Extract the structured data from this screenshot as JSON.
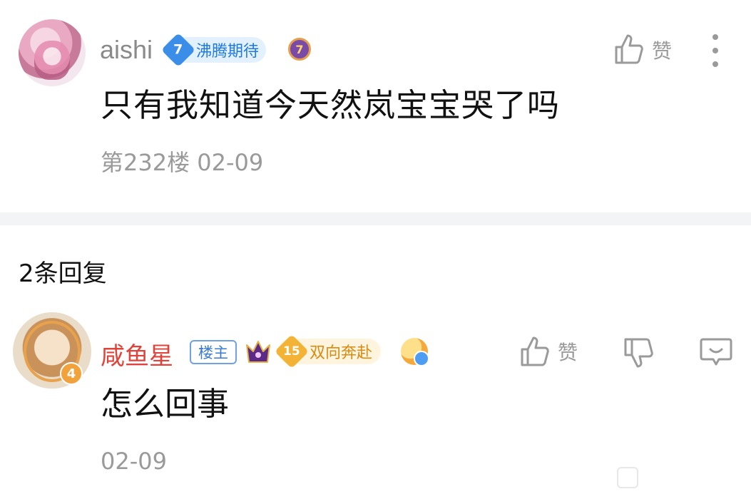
{
  "post": {
    "username": "aishi",
    "level": "7",
    "level_title": "沸腾期待",
    "medal_level": "7",
    "like_label": "赞",
    "text": "只有我知道今天然岚宝宝哭了吗",
    "meta": "第232楼 02-09"
  },
  "replies_header": "2条回复",
  "reply": {
    "username": "咸鱼星",
    "owner_tag": "楼主",
    "avatar_level": "4",
    "level": "15",
    "level_title": "双向奔赴",
    "like_label": "赞",
    "text": "怎么回事",
    "time": "02-09"
  },
  "colors": {
    "accent_blue": "#1e7ae0",
    "reply_name_red": "#e0433a",
    "muted_gray": "#9a9a9a",
    "separator": "#f3f4f6",
    "gold": "#f3b336"
  },
  "icons": [
    "like-icon",
    "more-icon",
    "crown-icon",
    "dislike-icon",
    "comment-icon",
    "emoji-badge-icon",
    "medal-icon"
  ]
}
